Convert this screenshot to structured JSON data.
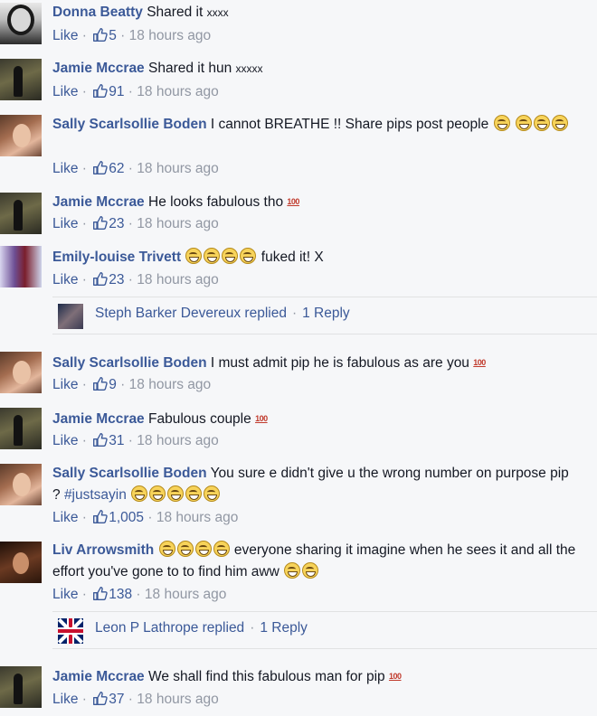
{
  "ui": {
    "like_label": "Like",
    "separator": "·"
  },
  "comments": [
    {
      "author": "Donna Beatty",
      "text": "Shared it",
      "small_text": "xxxx",
      "likes": "5",
      "time": "18 hours ago"
    },
    {
      "author": "Jamie Mccrae",
      "text": "Shared it hun",
      "small_text": "xxxxx",
      "likes": "91",
      "time": "18 hours ago"
    },
    {
      "author": "Sally Scarlsollie Boden",
      "text": "I cannot BREATHE !! Share pips post people",
      "likes": "62",
      "time": "18 hours ago"
    },
    {
      "author": "Jamie Mccrae",
      "text": "He looks fabulous tho",
      "likes": "23",
      "time": "18 hours ago"
    },
    {
      "author": "Emily-louise Trivett",
      "text": "fuked it! X",
      "likes": "23",
      "time": "18 hours ago",
      "reply": {
        "text": "Steph Barker Devereux replied",
        "count": "1 Reply"
      }
    },
    {
      "author": "Sally Scarlsollie Boden",
      "text": "I must admit pip he is fabulous as are you",
      "likes": "9",
      "time": "18 hours ago"
    },
    {
      "author": "Jamie Mccrae",
      "text": "Fabulous couple",
      "likes": "31",
      "time": "18 hours ago"
    },
    {
      "author": "Sally Scarlsollie Boden",
      "text": "You sure e didn't give u the wrong number on purpose pip ?",
      "hashtag": "#justsayin",
      "likes": "1,005",
      "time": "18 hours ago"
    },
    {
      "author": "Liv Arrowsmith",
      "text": "everyone sharing it imagine when he sees it and all the effort you've gone to to find him aww",
      "likes": "138",
      "time": "18 hours ago",
      "reply": {
        "text": "Leon P Lathrope replied",
        "count": "1 Reply"
      }
    },
    {
      "author": "Jamie Mccrae",
      "text": "We shall find this fabulous man for pip",
      "likes": "37",
      "time": "18 hours ago"
    }
  ],
  "emoji_labels": {
    "hundred": "100"
  },
  "colors": {
    "link": "#3b5998",
    "meta": "#9197a3",
    "background": "#f6f7f9"
  }
}
